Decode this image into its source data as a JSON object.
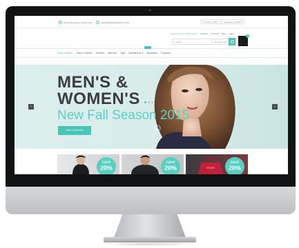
{
  "topbar": {
    "info_left": "HTTP://SHOP.ALL-SHOP.COM",
    "info_right": "INFO@DEMO.DEFAULT.COM",
    "currency": "Currency: USD ▾",
    "language": "Language: English ▾"
  },
  "header": {
    "account_links": [
      "Welcome to our Online Store!",
      "Wishlist",
      "Checkout",
      "Blog",
      "Login"
    ],
    "search_placeholder": "Search",
    "search_category": "All Categories"
  },
  "nav": {
    "items": [
      "Home Fashion",
      "Tools & Jackets",
      "Dresses",
      "Watches",
      "Tops",
      "Accessories ▾",
      "Swimwear",
      "Footwear"
    ]
  },
  "hero": {
    "title_line1": "MEN'S &",
    "title_line2": "WOMEN'S",
    "subtitle": "New Fall Season 2015",
    "cta": "View Collection",
    "slide_count": 3,
    "active_slide": 1
  },
  "promos": [
    {
      "label": "save",
      "amount": "20%"
    },
    {
      "label": "save",
      "amount": "20%"
    },
    {
      "label": "save",
      "amount": "20%"
    }
  ],
  "colors": {
    "accent": "#49c5b6",
    "accent_light": "#58cfc1",
    "title": "#3a3d44",
    "hero_bg": "#d7ecea"
  }
}
